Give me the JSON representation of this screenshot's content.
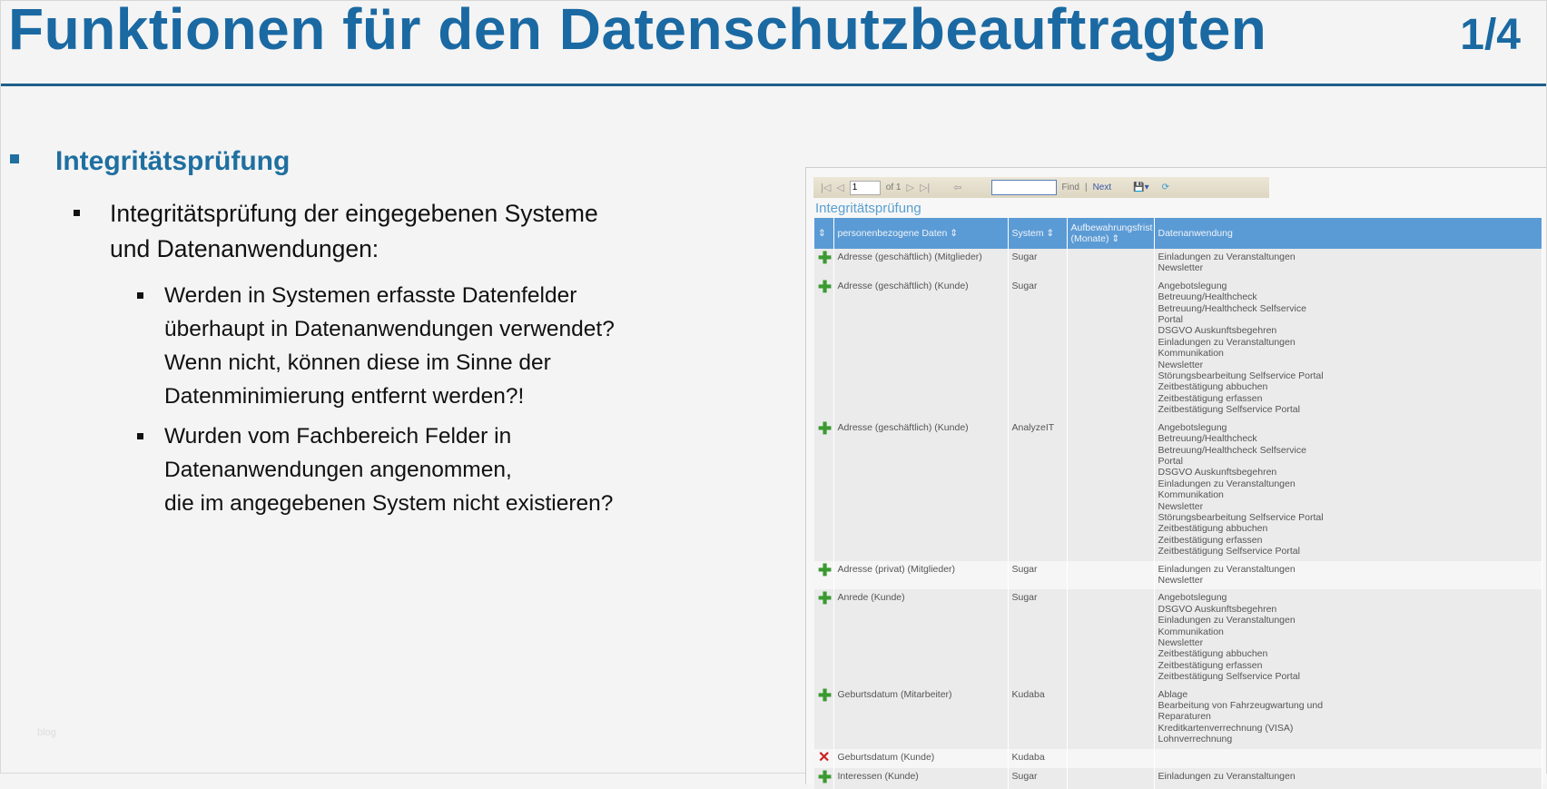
{
  "slide": {
    "title": "Funktionen für den Datenschutzbeauftragten",
    "page": "1/4",
    "watermark": "blog"
  },
  "content": {
    "heading": "Integritätsprüfung",
    "sub": [
      "Integritätsprüfung der eingegebenen Systeme",
      "und Datenanwendungen:"
    ],
    "q1": [
      "Werden in Systemen erfasste Datenfelder",
      "überhaupt in Datenanwendungen verwendet?",
      "Wenn nicht, können diese im Sinne der",
      "Datenminimierung entfernt werden?!"
    ],
    "q2": [
      "Wurden vom Fachbereich Felder in",
      "Datenanwendungen angenommen,",
      "die im angegebenen System nicht existieren?"
    ]
  },
  "report": {
    "page_value": "1",
    "of": "of 1",
    "find": "Find",
    "sep": "|",
    "next": "Next",
    "title": "Integritätsprüfung",
    "columns": [
      "⇕",
      "personenbezogene Daten ⇕",
      "System ⇕",
      "Aufbewahrungsfrist (Monate) ⇕",
      "Datenanwendung"
    ],
    "rows": [
      {
        "icon": "plus",
        "data": "Adresse (geschäftlich) (Mitglieder)",
        "system": "Sugar",
        "frist": "",
        "apps": "Einladungen zu Veranstaltungen\nNewsletter"
      },
      {
        "icon": "plus",
        "data": "Adresse (geschäftlich) (Kunde)",
        "system": "Sugar",
        "frist": "",
        "apps": "Angebotslegung\nBetreuung/Healthcheck\nBetreuung/Healthcheck Selfservice\nPortal\nDSGVO Auskunftsbegehren\nEinladungen zu Veranstaltungen\nKommunikation\nNewsletter\nStörungsbearbeitung Selfservice Portal\nZeitbestätigung abbuchen\nZeitbestätigung erfassen\nZeitbestätigung Selfservice Portal"
      },
      {
        "icon": "plus",
        "data": "Adresse (geschäftlich) (Kunde)",
        "system": "AnalyzeIT",
        "frist": "",
        "apps": "Angebotslegung\nBetreuung/Healthcheck\nBetreuung/Healthcheck Selfservice\nPortal\nDSGVO Auskunftsbegehren\nEinladungen zu Veranstaltungen\nKommunikation\nNewsletter\nStörungsbearbeitung Selfservice Portal\nZeitbestätigung abbuchen\nZeitbestätigung erfassen\nZeitbestätigung Selfservice Portal"
      },
      {
        "icon": "plus",
        "data": "Adresse (privat) (Mitglieder)",
        "system": "Sugar",
        "frist": "",
        "apps": "Einladungen zu Veranstaltungen\nNewsletter"
      },
      {
        "icon": "plus",
        "data": "Anrede (Kunde)",
        "system": "Sugar",
        "frist": "",
        "apps": "Angebotslegung\nDSGVO Auskunftsbegehren\nEinladungen zu Veranstaltungen\nKommunikation\nNewsletter\nZeitbestätigung abbuchen\nZeitbestätigung erfassen\nZeitbestätigung Selfservice Portal"
      },
      {
        "icon": "plus",
        "data": "Geburtsdatum (Mitarbeiter)",
        "system": "Kudaba",
        "frist": "",
        "apps": "Ablage\nBearbeitung von Fahrzeugwartung und\nReparaturen\nKreditkartenverrechnung (VISA)\nLohnverrechnung"
      },
      {
        "icon": "x",
        "data": "Geburtsdatum (Kunde)",
        "system": "Kudaba",
        "frist": "",
        "apps": ""
      },
      {
        "icon": "plus",
        "data": "Interessen (Kunde)",
        "system": "Sugar",
        "frist": "",
        "apps": "Einladungen zu Veranstaltungen"
      }
    ]
  }
}
